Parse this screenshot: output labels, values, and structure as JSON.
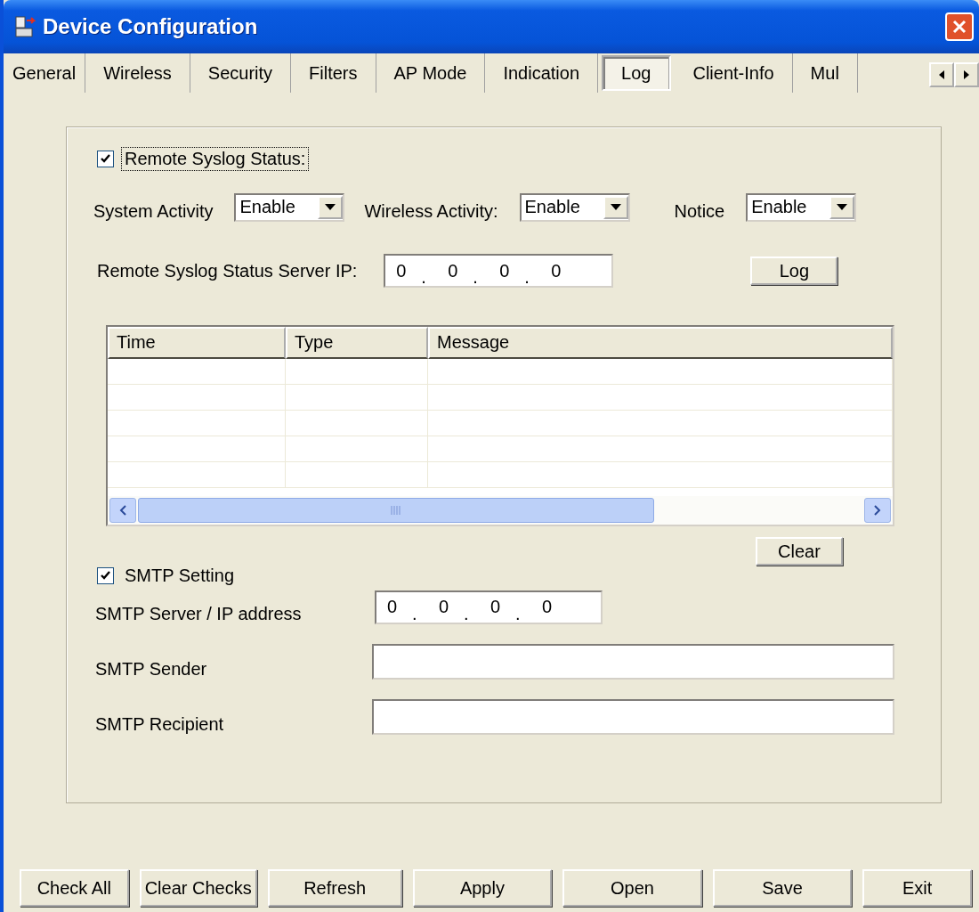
{
  "window": {
    "title": "Device Configuration"
  },
  "tabs": [
    {
      "label": "General",
      "selected": false
    },
    {
      "label": "Wireless",
      "selected": false
    },
    {
      "label": "Security",
      "selected": false
    },
    {
      "label": "Filters",
      "selected": false
    },
    {
      "label": "AP Mode",
      "selected": false
    },
    {
      "label": "Indication",
      "selected": false
    },
    {
      "label": "Log",
      "selected": true
    },
    {
      "label": "Client-Info",
      "selected": false
    },
    {
      "label": "Mul",
      "selected": false
    }
  ],
  "syslog": {
    "label": "Remote Syslog Status:",
    "checked": true,
    "focused": true,
    "selects": [
      {
        "label": "System Activity",
        "value": "Enable"
      },
      {
        "label": "Wireless Activity:",
        "value": "Enable"
      },
      {
        "label": "Notice",
        "value": "Enable"
      }
    ],
    "server_ip": {
      "label": "Remote Syslog Status Server IP:",
      "octets": [
        "0",
        "0",
        "0",
        "0"
      ],
      "separator": "."
    },
    "log_button": "Log"
  },
  "log_table": {
    "columns": [
      "Time",
      "Type",
      "Message"
    ]
  },
  "clear_button": "Clear",
  "smtp": {
    "label": "SMTP Setting",
    "checked": true,
    "server": {
      "label": "SMTP Server / IP address",
      "octets": [
        "0",
        "0",
        "0",
        "0"
      ],
      "separator": "."
    },
    "fields": [
      {
        "label": "SMTP Sender"
      },
      {
        "label": "SMTP Recipient"
      }
    ]
  },
  "buttons": [
    "Check All",
    "Clear Checks",
    "Refresh",
    "Apply",
    "Open",
    "Save",
    "Exit"
  ]
}
